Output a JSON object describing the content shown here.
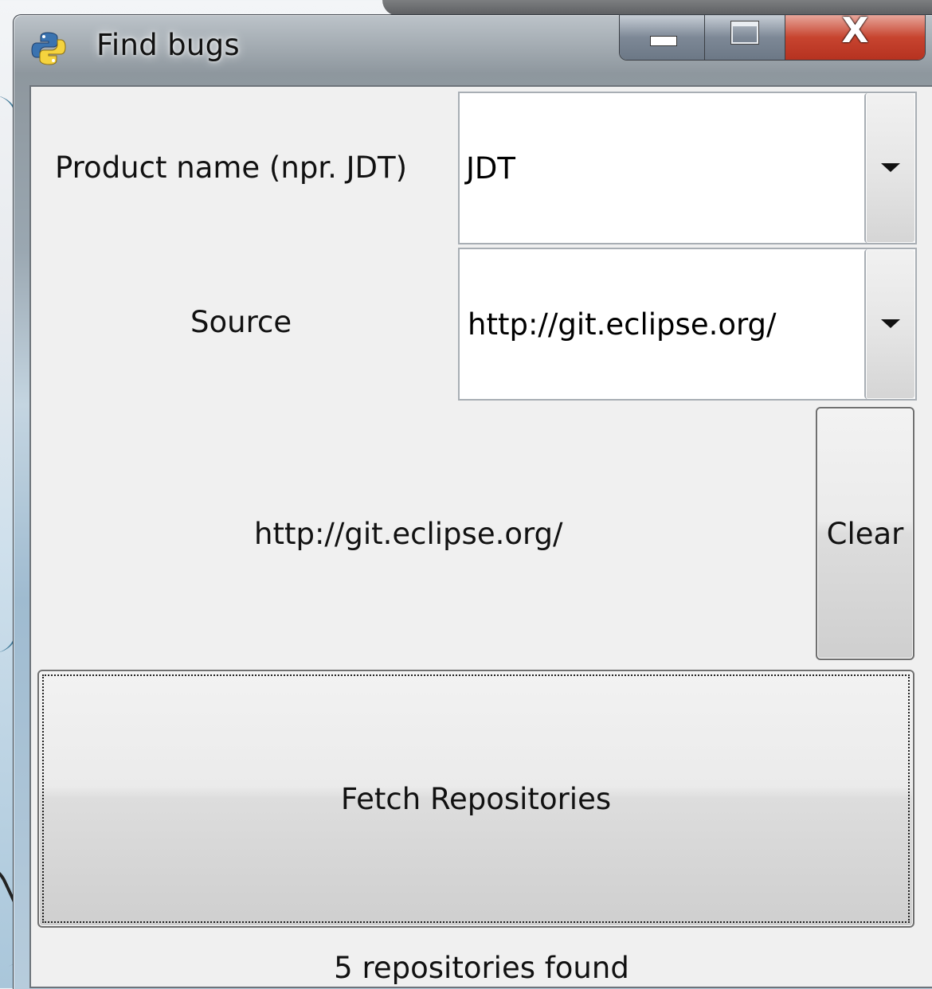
{
  "window": {
    "title": "Find bugs",
    "icon": "python-icon"
  },
  "caption": {
    "minimize_icon": "minimize-icon",
    "maximize_icon": "maximize-icon",
    "close_label": "X"
  },
  "form": {
    "product_label": "Product name (npr. JDT)",
    "product_value": "JDT",
    "source_label": "Source",
    "source_value": "http://git.eclipse.org/",
    "source_display": "http://git.eclipse.org/",
    "clear_label": "Clear",
    "fetch_label": "Fetch Repositories",
    "status_text": "5 repositories found"
  },
  "colors": {
    "close_button": "#c7442f",
    "client_background": "#f0f0f0"
  }
}
